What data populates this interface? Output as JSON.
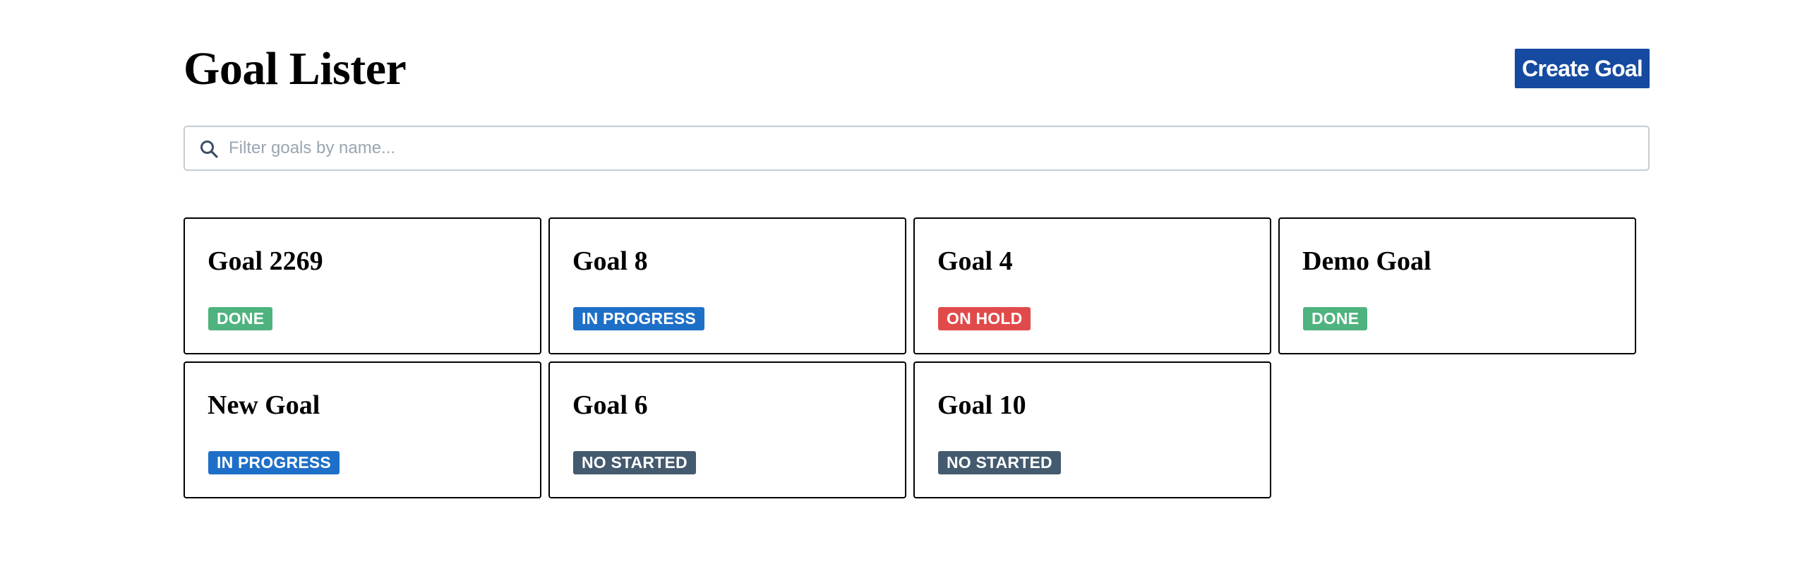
{
  "header": {
    "title": "Goal Lister",
    "create_button_label": "Create Goal"
  },
  "search": {
    "icon": "search-icon",
    "placeholder": "Filter goals by name...",
    "value": ""
  },
  "status_colors": {
    "DONE": "#4fb37f",
    "IN PROGRESS": "#1e6fc8",
    "ON HOLD": "#e14a4a",
    "NO STARTED": "#445a6f"
  },
  "goals": [
    {
      "title": "Goal 2269",
      "status": "DONE"
    },
    {
      "title": "Goal 8",
      "status": "IN PROGRESS"
    },
    {
      "title": "Goal 4",
      "status": "ON HOLD"
    },
    {
      "title": "Demo Goal",
      "status": "DONE"
    },
    {
      "title": "New Goal",
      "status": "IN PROGRESS"
    },
    {
      "title": "Goal 6",
      "status": "NO STARTED"
    },
    {
      "title": "Goal 10",
      "status": "NO STARTED"
    }
  ]
}
